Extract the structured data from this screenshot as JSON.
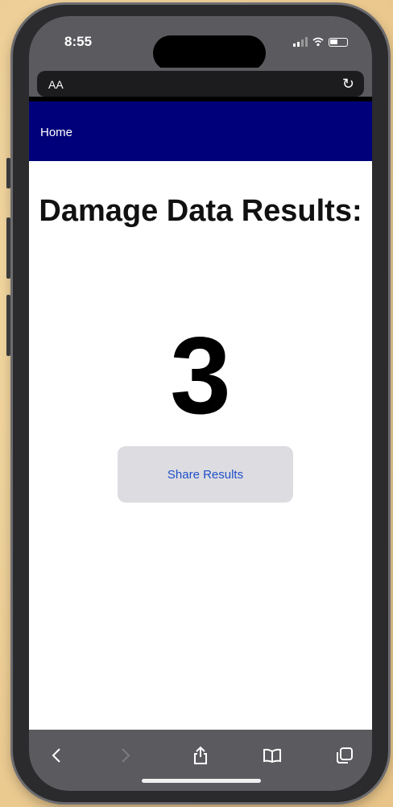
{
  "status_bar": {
    "time": "8:55"
  },
  "url_bar": {
    "text_size_label": "AA"
  },
  "nav": {
    "home_label": "Home"
  },
  "main": {
    "title": "Damage Data Results:",
    "result_value": "3",
    "share_button_label": "Share Results"
  },
  "toolbar": {
    "icons": [
      "back-icon",
      "forward-icon",
      "share-icon",
      "bookmarks-icon",
      "tabs-icon"
    ]
  },
  "colors": {
    "nav_background": "#00007a",
    "share_button_text": "#1f4fc8",
    "share_button_background": "#dcdce1"
  }
}
